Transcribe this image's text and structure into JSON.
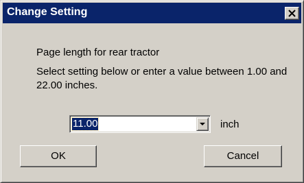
{
  "window": {
    "title": "Change Setting",
    "close_icon": "close-icon"
  },
  "message": {
    "title": "Page length for rear tractor",
    "body": "Select setting below or enter a value between 1.00 and 22.00 inches."
  },
  "combo": {
    "value": "11.00",
    "unit": "inch",
    "arrow_icon": "chevron-down-icon"
  },
  "buttons": {
    "ok": "OK",
    "cancel": "Cancel"
  },
  "colors": {
    "titlebar": "#0a246a",
    "face": "#d4d0c8",
    "selection": "#0a246a"
  }
}
